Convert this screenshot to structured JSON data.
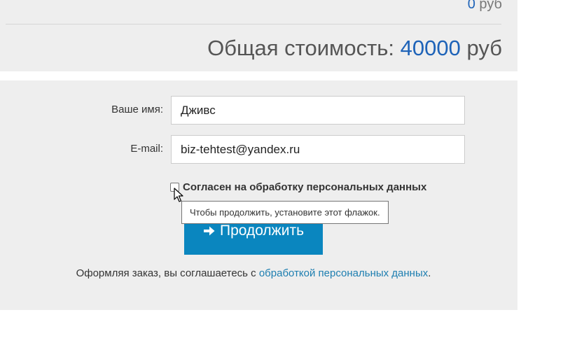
{
  "cart_summary": {
    "partial_value": "0",
    "partial_currency": "руб",
    "total_label": "Общая стоимость:",
    "total_amount": "40000",
    "total_currency": "руб"
  },
  "form": {
    "name_label": "Ваше имя:",
    "name_value": "Дживс",
    "email_label": "E-mail:",
    "email_value": "biz-tehtest@yandex.ru",
    "consent_label": "Согласен на обработку персональных данных",
    "consent_checked": false,
    "continue_label": "Продолжить",
    "note_prefix": "Оформляя заказ, вы соглашаетесь с",
    "note_link": "обработкой персональных данных",
    "note_suffix": "."
  },
  "tooltip": {
    "text": "Чтобы продолжить, установите этот флажок."
  },
  "icons": {
    "continue": "arrow-right-icon",
    "cursor": "mouse-pointer-icon"
  },
  "colors": {
    "accent": "#1e63b8",
    "button": "#0a86bf",
    "link": "#1d7eb0",
    "panel": "#eeeeee"
  }
}
